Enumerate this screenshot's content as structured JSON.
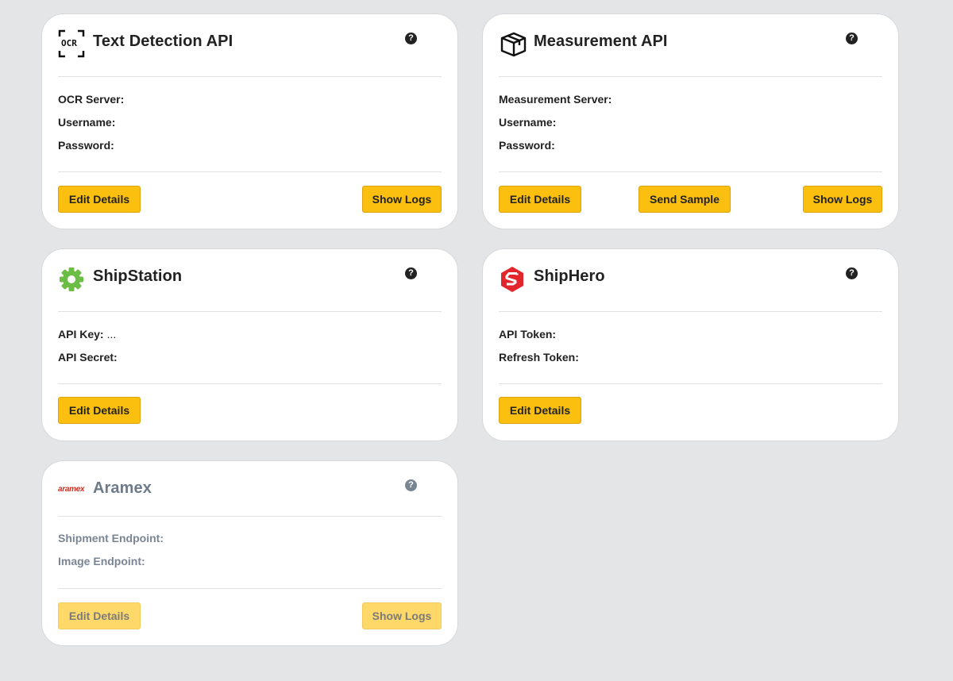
{
  "cards": [
    {
      "title": "Text Detection API",
      "logo": "ocr-icon",
      "logo_text": "OCR",
      "fields": [
        {
          "label": "OCR Server:",
          "value": ""
        },
        {
          "label": "Username:",
          "value": ""
        },
        {
          "label": "Password:",
          "value": ""
        }
      ],
      "buttons": {
        "edit": "Edit Details",
        "logs": "Show Logs"
      }
    },
    {
      "title": "Measurement API",
      "logo": "box-icon",
      "fields": [
        {
          "label": "Measurement Server:",
          "value": ""
        },
        {
          "label": "Username:",
          "value": ""
        },
        {
          "label": "Password:",
          "value": ""
        }
      ],
      "buttons": {
        "edit": "Edit Details",
        "sample": "Send Sample",
        "logs": "Show Logs"
      }
    },
    {
      "title": "ShipStation",
      "logo": "gear-icon",
      "fields": [
        {
          "label": "API Key:",
          "value": "..."
        },
        {
          "label": "API Secret:",
          "value": ""
        }
      ],
      "buttons": {
        "edit": "Edit Details"
      }
    },
    {
      "title": "ShipHero",
      "logo": "shiphero-icon",
      "fields": [
        {
          "label": "API Token:",
          "value": ""
        },
        {
          "label": "Refresh Token:",
          "value": ""
        }
      ],
      "buttons": {
        "edit": "Edit Details"
      }
    },
    {
      "title": "Aramex",
      "logo": "aramex-icon",
      "logo_text": "aramex",
      "disabled": true,
      "fields": [
        {
          "label": "Shipment Endpoint:",
          "value": ""
        },
        {
          "label": "Image Endpoint:",
          "value": ""
        }
      ],
      "buttons": {
        "edit": "Edit Details",
        "logs": "Show Logs"
      }
    }
  ],
  "help_icon": "question-circle-icon",
  "help_glyph": "?",
  "colors": {
    "background": "#e4e5e7",
    "card": "#ffffff",
    "button": "#fbbf0f",
    "button_disabled": "#fed96a",
    "shipstation_green": "#6bbd45",
    "shiphero_red": "#e3262b",
    "aramex_red": "#d52b1e"
  }
}
